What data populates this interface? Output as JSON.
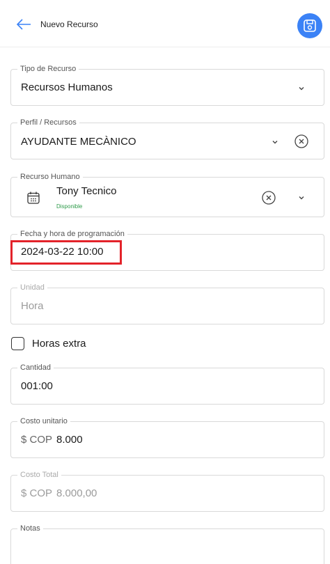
{
  "header": {
    "title": "Nuevo Recurso"
  },
  "tipo_recurso": {
    "label": "Tipo de Recurso",
    "value": "Recursos Humanos"
  },
  "perfil": {
    "label": "Perfil / Recursos",
    "value": "AYUDANTE MECÀNICO"
  },
  "recurso_humano": {
    "label": "Recurso Humano",
    "name": "Tony Tecnico",
    "status": "Disponible"
  },
  "fecha": {
    "label": "Fecha y hora de programación",
    "value": "2024-03-22 10:00"
  },
  "unidad": {
    "label": "Unidad",
    "value": "Hora"
  },
  "horas_extra": {
    "label": "Horas extra",
    "checked": false
  },
  "cantidad": {
    "label": "Cantidad",
    "value": "001:00"
  },
  "costo_unitario": {
    "label": "Costo unitario",
    "currency": "$ COP",
    "value": "8.000"
  },
  "costo_total": {
    "label": "Costo Total",
    "currency": "$ COP",
    "value": "8.000,00"
  },
  "notas": {
    "label": "Notas",
    "value": ""
  },
  "colors": {
    "accent": "#3b82f6",
    "status_green": "#2e9b4a",
    "highlight": "#e3232a"
  }
}
